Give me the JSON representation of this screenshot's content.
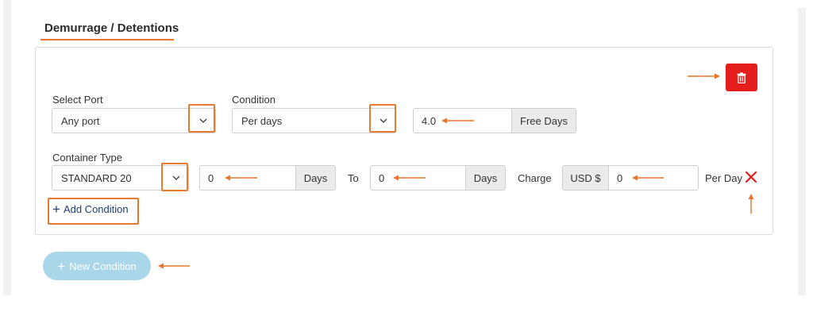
{
  "section": {
    "title": "Demurrage / Detentions"
  },
  "row1": {
    "port_label": "Select Port",
    "port_value": "Any port",
    "condition_label": "Condition",
    "condition_value": "Per days",
    "free_days_value": "4.0",
    "free_days_addon": "Free Days"
  },
  "row2": {
    "container_label": "Container Type",
    "container_value": "STANDARD 20",
    "from_value": "0",
    "from_addon": "Days",
    "to_label": "To",
    "to_value": "0",
    "to_addon": "Days",
    "charge_label": "Charge",
    "currency_prefix": "USD $",
    "charge_value": "0",
    "per_day_label": "Per Day"
  },
  "actions": {
    "add_condition_label": "Add Condition",
    "new_condition_label": "New Condition",
    "plus_glyph": "+"
  },
  "colors": {
    "accent": "#e8762b",
    "danger": "#e41d1d",
    "link": "#1f3f77",
    "disabled_button": "#a9d6e9"
  },
  "icons": {
    "delete": "trash-icon",
    "remove": "close-icon",
    "dropdown": "chevron-down-icon"
  }
}
